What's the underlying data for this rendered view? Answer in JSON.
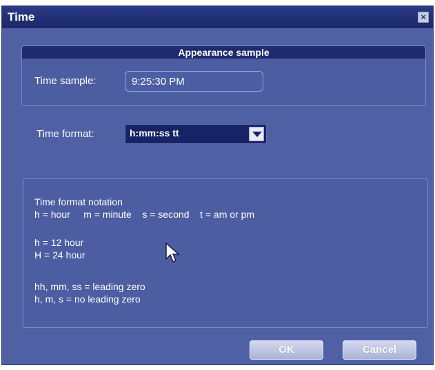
{
  "window": {
    "title": "Time",
    "close_label": "×"
  },
  "sample": {
    "header": "Appearance sample",
    "label": "Time sample:",
    "value": "9:25:30 PM"
  },
  "format": {
    "label": "Time format:",
    "selected": "h:mm:ss tt"
  },
  "notation": {
    "title": "Time format notation",
    "legend": "h = hour     m = minute    s = second    t = am or pm",
    "h12": "h = 12 hour",
    "h24": "H = 24 hour",
    "leading": "hh, mm, ss = leading zero",
    "no_leading": "h, m, s = no leading zero"
  },
  "buttons": {
    "ok": "OK",
    "cancel": "Cancel"
  },
  "icons": {
    "close": "close-icon",
    "dropdown": "chevron-down-icon",
    "cursor": "mouse-pointer-icon"
  }
}
